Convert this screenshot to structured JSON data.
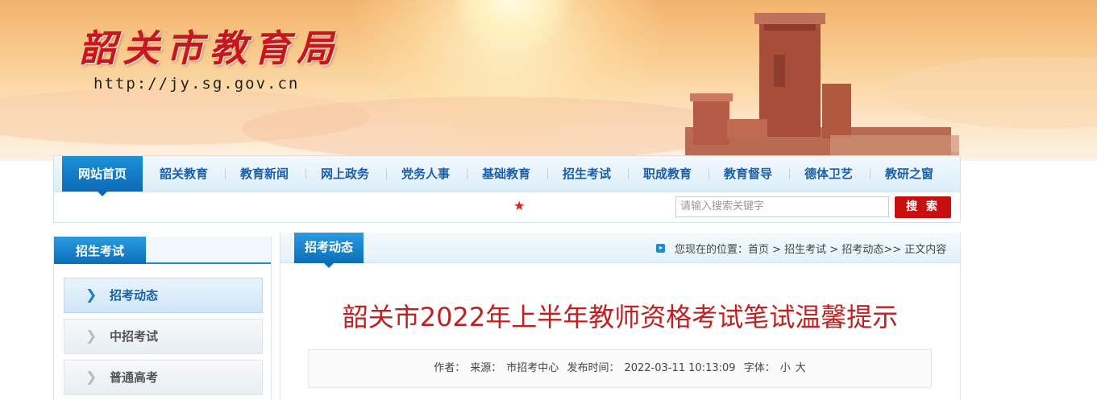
{
  "header": {
    "site_title": "韶关市教育局",
    "site_url": "http://jy.sg.gov.cn"
  },
  "nav": {
    "items": [
      {
        "label": "网站首页",
        "active": true
      },
      {
        "label": "韶关教育"
      },
      {
        "label": "教育新闻"
      },
      {
        "label": "网上政务"
      },
      {
        "label": "党务人事"
      },
      {
        "label": "基础教育"
      },
      {
        "label": "招生考试"
      },
      {
        "label": "职成教育"
      },
      {
        "label": "教育督导"
      },
      {
        "label": "德体卫艺"
      },
      {
        "label": "教研之窗"
      }
    ],
    "search_placeholder": "请输入搜索关键字",
    "search_button": "搜 索"
  },
  "sidebar": {
    "title": "招生考试",
    "items": [
      {
        "label": "招考动态",
        "active": true
      },
      {
        "label": "中招考试"
      },
      {
        "label": "普通高考"
      }
    ]
  },
  "main": {
    "tab": "招考动态",
    "location_prefix": "您现在的位置：",
    "breadcrumb": "首页 > 招生考试 > 招考动态>> 正文内容",
    "article_title": "韶关市2022年上半年教师资格考试笔试温馨提示",
    "meta": {
      "author_label": "作者：",
      "source_label": "来源：",
      "source_value": "市招考中心",
      "publish_label": "发布时间：",
      "publish_value": "2022-03-11 10:13:09",
      "font_label": "字体：",
      "font_small": "小",
      "font_large": "大"
    }
  },
  "colors": {
    "brand_blue": "#0b6ab6",
    "title_red": "#c0201f",
    "search_red": "#c80f0f"
  }
}
